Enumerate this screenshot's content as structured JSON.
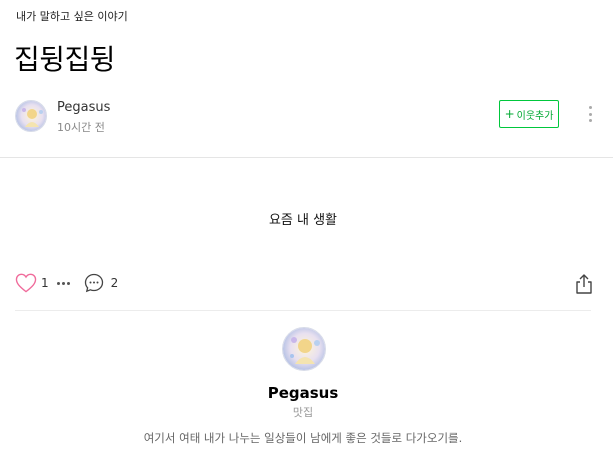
{
  "post": {
    "category": "내가 말하고 싶은 이야기",
    "title": "집뒹집뒹",
    "author_name": "Pegasus",
    "time": "10시간 전",
    "body": "요즘 내 생활"
  },
  "actions": {
    "neighbor_plus": "+",
    "neighbor_label": "이웃추가",
    "like_count": "1",
    "comment_count": "2"
  },
  "profile": {
    "name": "Pegasus",
    "category": "맛집",
    "description": "여기서 여태 내가 나누는 일상들이 남에게 좋은 것들로 다가오기를."
  },
  "colors": {
    "accent_green": "#00c73c",
    "heart_pink": "#f06b9b",
    "divider": "#e5e5e5"
  },
  "icons": [
    "heart-icon",
    "more-dots-icon",
    "comment-icon",
    "share-icon",
    "more-vertical-icon"
  ]
}
